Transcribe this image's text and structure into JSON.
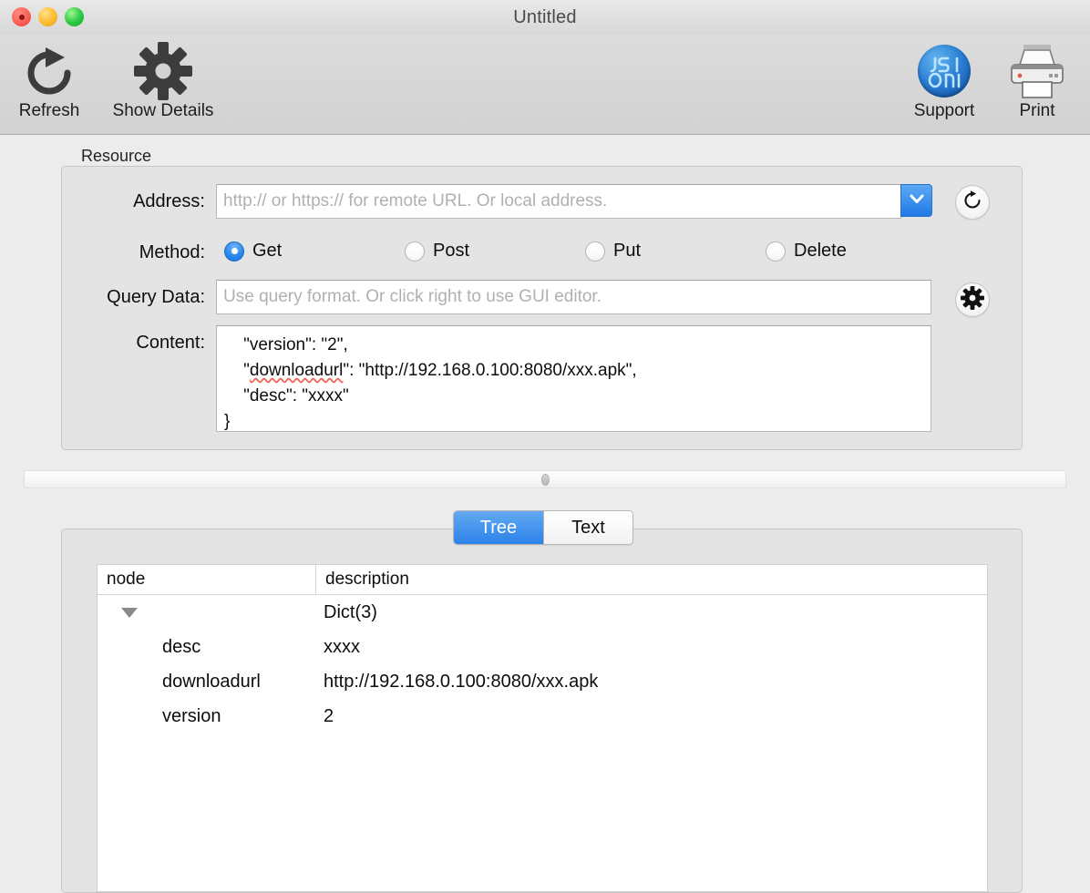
{
  "window": {
    "title": "Untitled",
    "traffic_lights": [
      "close",
      "minimize",
      "zoom"
    ]
  },
  "toolbar": {
    "items": [
      {
        "label": "Refresh",
        "icon": "refresh-icon"
      },
      {
        "label": "Show Details",
        "icon": "gear-icon"
      },
      {
        "label": "Support",
        "icon": "json-logo-icon"
      },
      {
        "label": "Print",
        "icon": "printer-icon"
      }
    ]
  },
  "resource": {
    "legend": "Resource",
    "address": {
      "label": "Address:",
      "value": "",
      "placeholder": "http:// or https:// for remote URL. Or local address.",
      "dropdown_icon": "chevron-down-icon",
      "reload_icon": "reload-icon"
    },
    "method": {
      "label": "Method:",
      "selected": "Get",
      "options": [
        "Get",
        "Post",
        "Put",
        "Delete"
      ]
    },
    "query_data": {
      "label": "Query Data:",
      "value": "",
      "placeholder": "Use query format. Or click right to use GUI editor.",
      "editor_icon": "gear-icon"
    },
    "content": {
      "label": "Content:",
      "lines": [
        "    \"version\": \"2\",",
        "    \"downloadurl\": \"http://192.168.0.100:8080/xxx.apk\",",
        "    \"desc\": \"xxxx\"",
        "}"
      ],
      "misspelled_word": "downloadurl"
    }
  },
  "splitter": {
    "grip_icon": "splitter-grip-icon"
  },
  "view_mode": {
    "selected": "Tree",
    "options": [
      "Tree",
      "Text"
    ]
  },
  "results": {
    "columns": [
      "node",
      "description"
    ],
    "rows": [
      {
        "node": "",
        "description": "Dict(3)",
        "expanded": true,
        "level": 0
      },
      {
        "node": "desc",
        "description": "xxxx",
        "level": 1
      },
      {
        "node": "downloadurl",
        "description": "http://192.168.0.100:8080/xxx.apk",
        "level": 1
      },
      {
        "node": "version",
        "description": "2",
        "level": 1
      }
    ]
  },
  "colors": {
    "accent_blue": "#2b82e8",
    "window_bg": "#ececec",
    "panel_bg": "#e4e4e4",
    "toolbar_bg": "#d6d6d6",
    "spellcheck_red": "#f0675c"
  }
}
